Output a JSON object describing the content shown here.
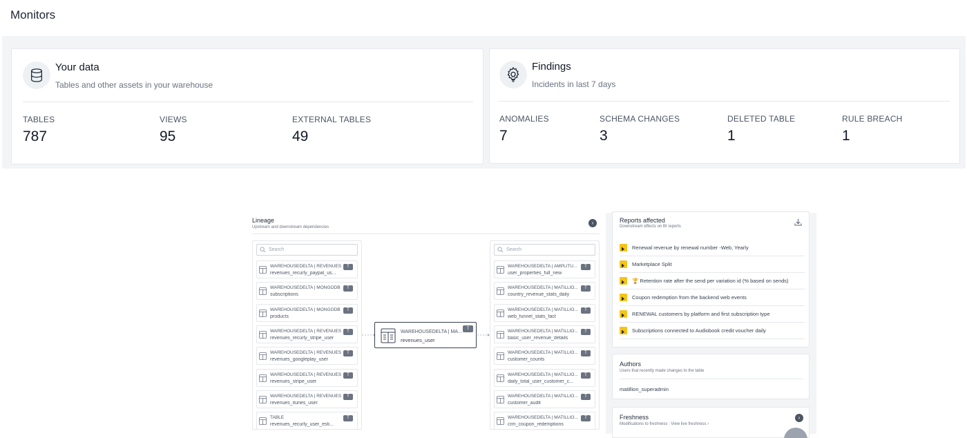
{
  "header": {
    "title": "Monitors"
  },
  "your_data": {
    "title": "Your data",
    "subtitle": "Tables and other assets in your warehouse",
    "icon": "database-icon",
    "stats": [
      {
        "label": "TABLES",
        "value": "787"
      },
      {
        "label": "VIEWS",
        "value": "95"
      },
      {
        "label": "EXTERNAL TABLES",
        "value": "49"
      }
    ]
  },
  "findings": {
    "title": "Findings",
    "subtitle": "Incidents in last 7 days",
    "icon": "bulb-gear-icon",
    "stats": [
      {
        "label": "ANOMALIES",
        "value": "7"
      },
      {
        "label": "SCHEMA CHANGES",
        "value": "3"
      },
      {
        "label": "DELETED TABLE",
        "value": "1"
      },
      {
        "label": "RULE BREACH",
        "value": "1"
      }
    ]
  },
  "lineage": {
    "title": "Lineage",
    "subtitle": "Upstream and downstream dependencies",
    "search_placeholder": "Search",
    "upstream": [
      {
        "path": "WAREHOUSEDELTA | REVENUES",
        "name": "revenues_recurly_paypal_us...",
        "badge": "T"
      },
      {
        "path": "WAREHOUSEDELTA | MONGODB",
        "name": "subscriptions",
        "badge": "T"
      },
      {
        "path": "WAREHOUSEDELTA | MONGODB",
        "name": "products",
        "badge": "T"
      },
      {
        "path": "WAREHOUSEDELTA | REVENUES",
        "name": "revenues_recurly_stripe_user",
        "badge": "T"
      },
      {
        "path": "WAREHOUSEDELTA | REVENUES",
        "name": "revenues_googleplay_user",
        "badge": "T"
      },
      {
        "path": "WAREHOUSEDELTA | REVENUES",
        "name": "revenues_stripe_user",
        "badge": "T"
      },
      {
        "path": "WAREHOUSEDELTA | REVENUES",
        "name": "revenues_itunes_user",
        "badge": "T"
      },
      {
        "path": "TABLE",
        "name": "revenues_recurly_user_esti...",
        "badge": "T"
      }
    ],
    "center": {
      "path": "WAREHOUSEDELTA | MA...",
      "name": "revenues_user",
      "badge": "T"
    },
    "downstream": [
      {
        "path": "WAREHOUSEDELTA | AMPLITU...",
        "name": "user_properties_full_new",
        "badge": "T"
      },
      {
        "path": "WAREHOUSEDELTA | MATILLIO...",
        "name": "country_revenue_stats_daily",
        "badge": "T"
      },
      {
        "path": "WAREHOUSEDELTA | MATILLIO...",
        "name": "web_funnel_stats_fact",
        "badge": "T"
      },
      {
        "path": "WAREHOUSEDELTA | MATILLIO...",
        "name": "basic_user_revenue_details",
        "badge": "T"
      },
      {
        "path": "WAREHOUSEDELTA | MATILLIO...",
        "name": "customer_counts",
        "badge": "T"
      },
      {
        "path": "WAREHOUSEDELTA | MATILLIO...",
        "name": "daily_total_user_customer_c...",
        "badge": "T"
      },
      {
        "path": "WAREHOUSEDELTA | MATILLIO...",
        "name": "customer_audit",
        "badge": "T"
      },
      {
        "path": "WAREHOUSEDELTA | MATILLIO...",
        "name": "crm_coupon_redemptions",
        "badge": "T"
      }
    ]
  },
  "reports": {
    "title": "Reports affected",
    "subtitle": "Downstream effects on BI reports",
    "items": [
      "Renewal revenue by renewal number -Web, Yearly",
      "Marketplace Split",
      "🏆 Retention rate after the send per variation id (% based on sends)",
      "Coupon redemption from the backend web events",
      "RENEWAL customers by platform and first subscription type",
      "Subscriptions connected to Audiobook credit voucher daily"
    ]
  },
  "authors": {
    "title": "Authors",
    "subtitle": "Users that recently made changes to the table",
    "items": [
      "matillion_superadmin"
    ]
  },
  "freshness": {
    "title": "Freshness",
    "subtitle": "Modifications to freshness",
    "link": "View live freshness ›"
  }
}
